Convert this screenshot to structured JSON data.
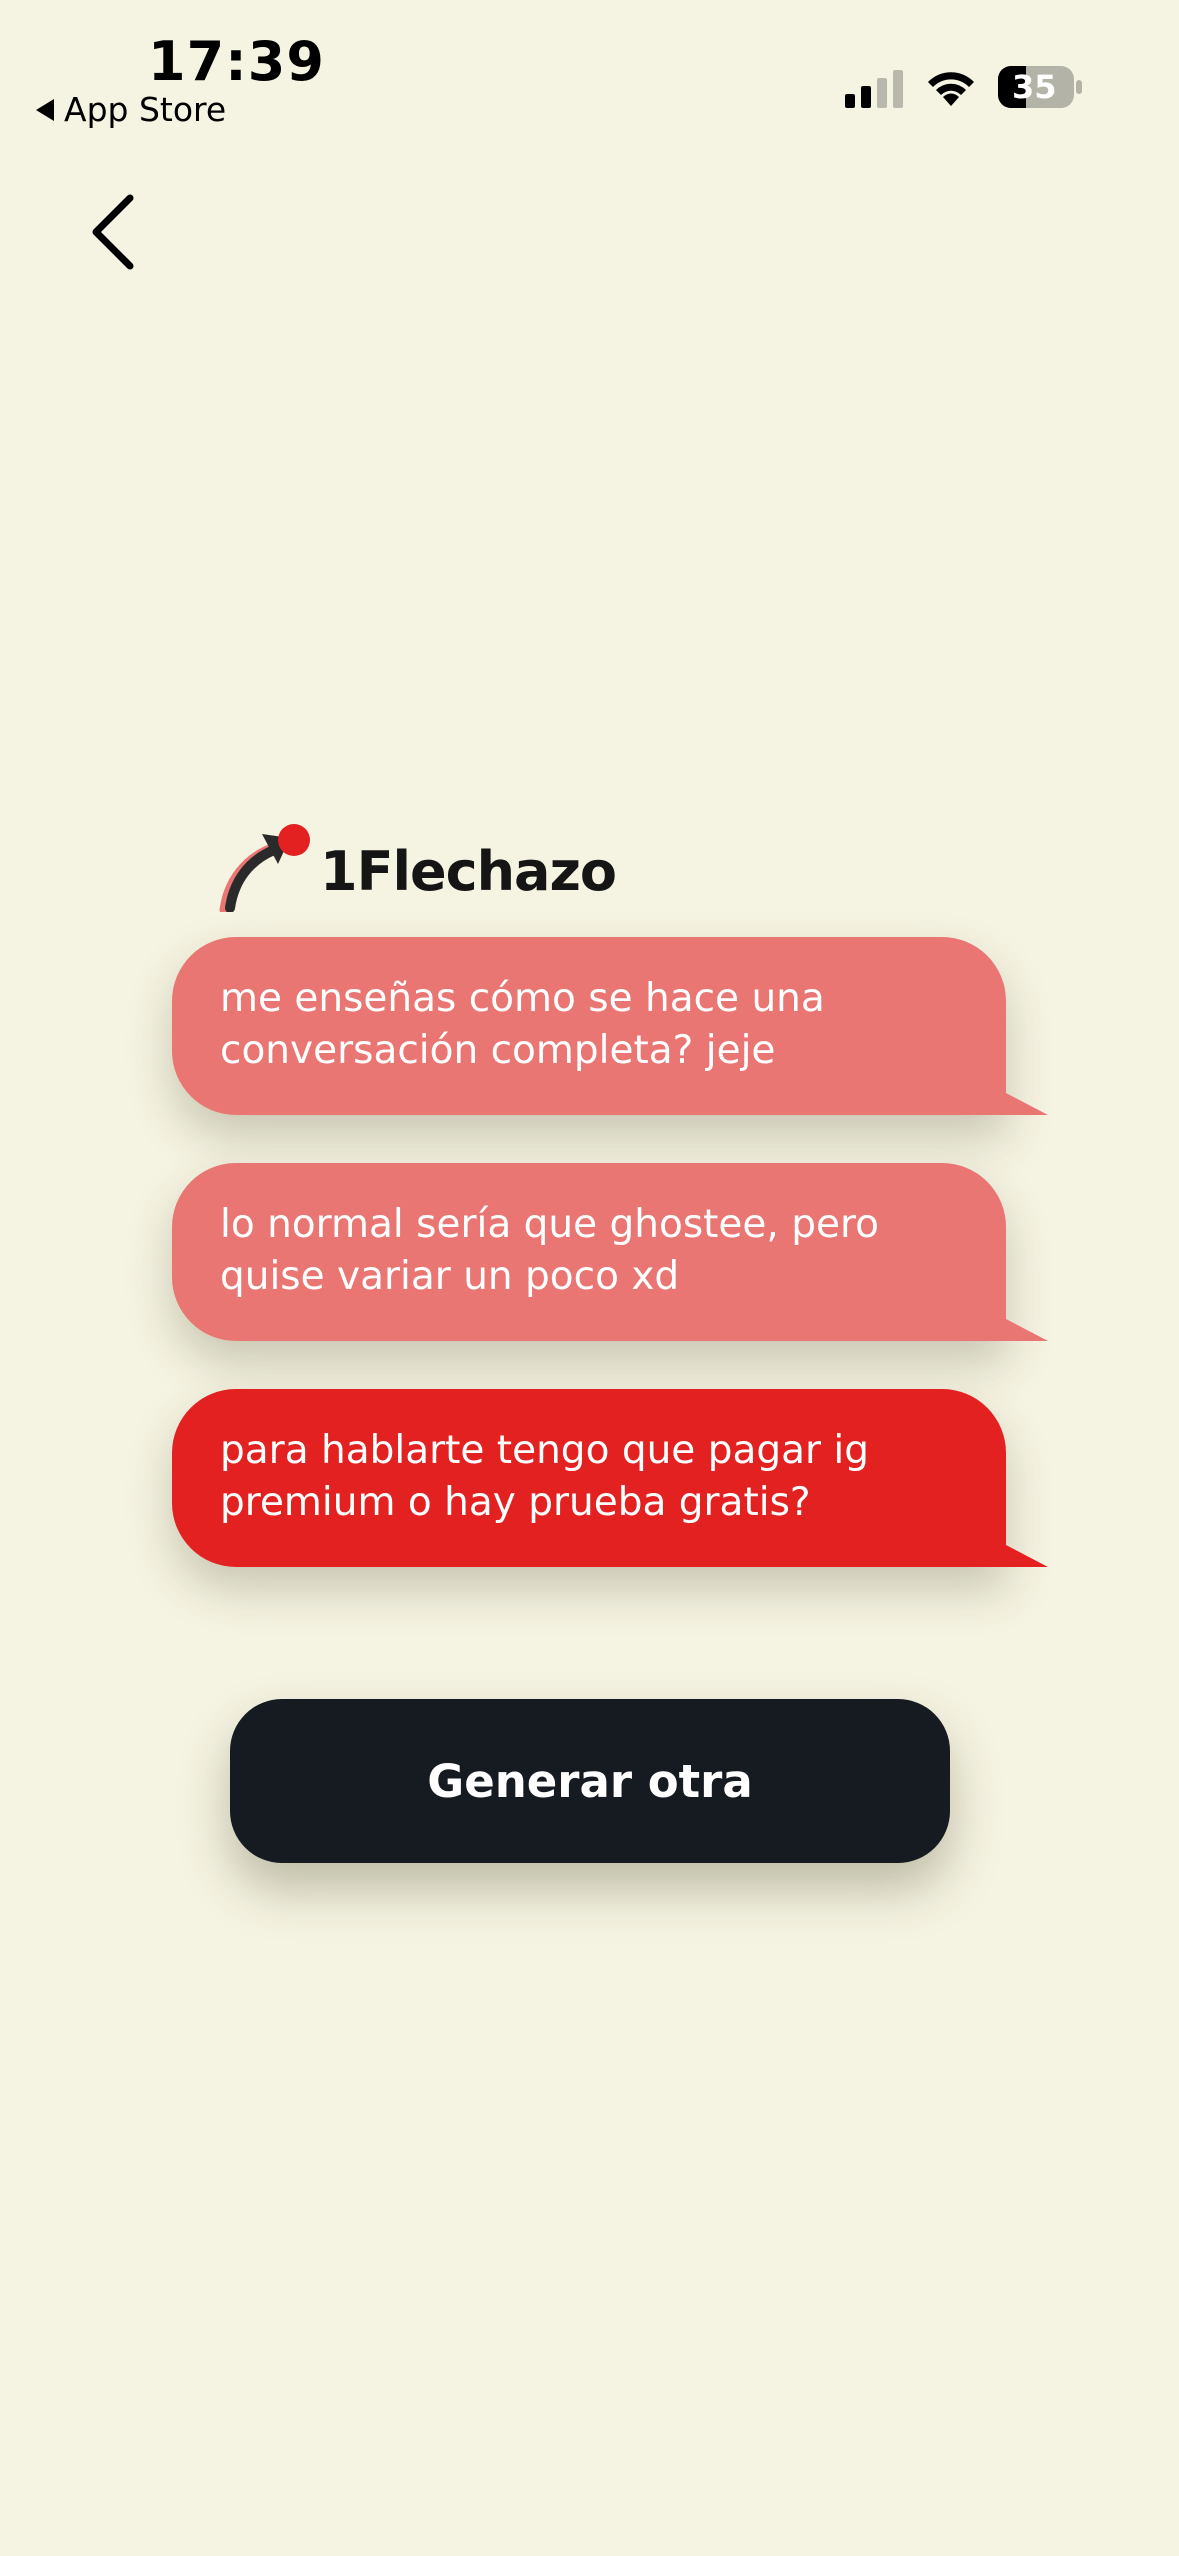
{
  "status_bar": {
    "time": "17:39",
    "back_app": "App Store",
    "battery": "35",
    "signal_icon": "cellular-signal-icon",
    "wifi_icon": "wifi-icon",
    "battery_icon": "battery-icon"
  },
  "header": {
    "back_icon": "chevron-left-icon"
  },
  "brand": {
    "name": "1Flechazo",
    "logo_icon": "arrow-logo-icon",
    "accent": "#e32121"
  },
  "messages": [
    {
      "text": "me enseñas cómo se hace una conversación completa? jeje",
      "color": "#e97672"
    },
    {
      "text": "lo normal sería que ghostee, pero quise variar un poco xd",
      "color": "#e97672"
    },
    {
      "text": "para hablarte tengo que pagar ig premium o hay prueba gratis?",
      "color": "#e32121"
    }
  ],
  "actions": {
    "generate_label": "Generar otra"
  },
  "colors": {
    "background": "#f5f3e1",
    "button": "#161a21"
  }
}
